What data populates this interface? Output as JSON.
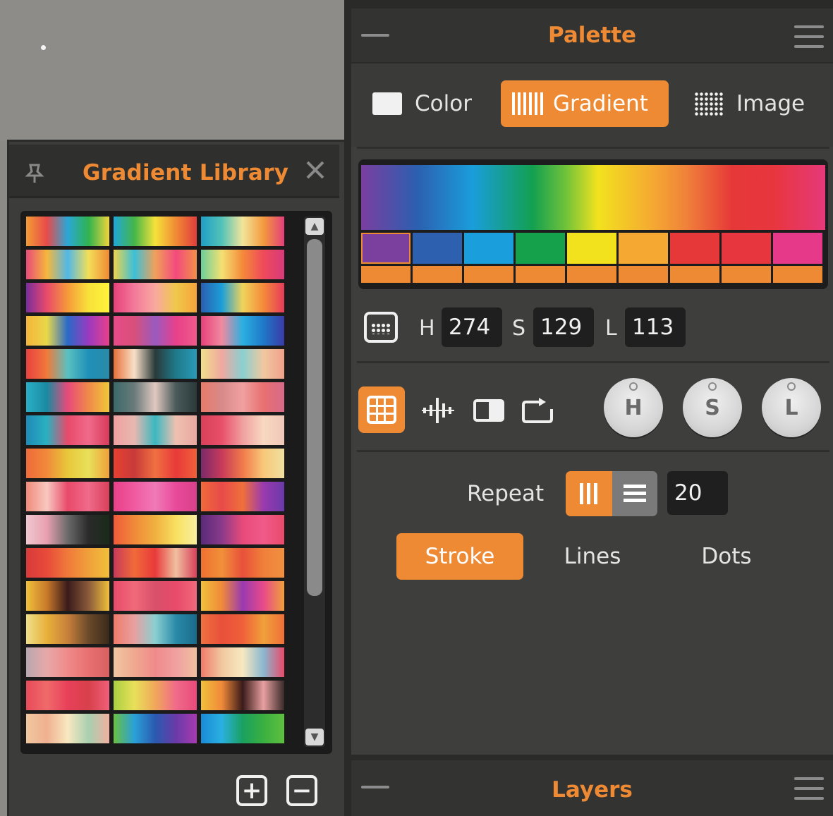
{
  "colors": {
    "accent": "#ee8a34",
    "panel": "#3e3e3d",
    "header": "#333332"
  },
  "gradient_library": {
    "title": "Gradient Library",
    "icons": {
      "pin": "pin-icon",
      "close": "close-icon",
      "add": "add-icon",
      "remove": "remove-icon"
    },
    "swatches": [
      "linear-gradient(90deg,#f39c34,#e84a4a,#2aa7d8,#2fb34f,#f0d43a)",
      "linear-gradient(90deg,#1fa7d8,#45b649,#f5e23a,#f08a34,#e23d3d)",
      "linear-gradient(90deg,#1f9ec6,#52c3b8,#f2e59a,#f39a3e,#e33f7a)",
      "linear-gradient(90deg,#e84a7a,#f6b73c,#52b8e6,#f3df58,#f08a34)",
      "linear-gradient(90deg,#f1d34a,#3bc0d8,#f0a15a,#f34a7d,#f2904a)",
      "linear-gradient(90deg,#6bcf9a,#f4e173,#f48a3a,#ef4a5a,#d83a7a)",
      "linear-gradient(90deg,#7a2c9e,#e94a6a,#f69a3a,#f7e23a,#fff23a)",
      "linear-gradient(90deg,#e8407a,#f27a9a,#f9a8a0,#f0c84a,#f6a43a)",
      "linear-gradient(90deg,#2a5fb0,#1c9ed8,#f0d45a,#f58a3a,#e63c5a)",
      "linear-gradient(90deg,#f6b43a,#e8d84a,#2a6ac8,#9a3ac0,#e8408a)",
      "linear-gradient(90deg,#e84a8a,#d8507a,#9a5ac0,#e8408a,#f05a8a)",
      "linear-gradient(90deg,#e8407a,#f08aa0,#2ab0e0,#1f78c8,#3a3aa8)",
      "linear-gradient(90deg,#e84040,#f07a3a,#5ac0c0,#1f90b8,#2a8aa8)",
      "linear-gradient(90deg,#e8703a,#f8e0c8,#2a3a3a,#1f7a8a,#2a9ab8)",
      "linear-gradient(90deg,#f0e08a,#f0a8a0,#8ad0d0,#f0c8a0,#f0a08a)",
      "linear-gradient(90deg,#2ab0c8,#1a8aa0,#e84a7a,#f08a4a,#f0c83a)",
      "linear-gradient(90deg,#3a6a6a,#6a7a7a,#e0c8c0,#4a5a5a,#2a3a3a)",
      "linear-gradient(90deg,#e87a6a,#d88a8a,#f0a0a0,#e87070,#d86a8a)",
      "linear-gradient(90deg,#1f8ab8,#2ab0c0,#e84a6a,#f06a8a,#d83a5a)",
      "linear-gradient(90deg,#f0a0a0,#e8b8b0,#3ab8c0,#f0c0b0,#e8a8a0)",
      "linear-gradient(90deg,#d8405a,#e8506a,#f0a0a0,#f8d8c0,#f0c8b8)",
      "linear-gradient(90deg,#f06a3a,#f08a3a,#e8c83a,#e8e05a,#f0a03a)",
      "linear-gradient(90deg,#e84030,#c83a3a,#f07040,#e83a3a,#f0603a)",
      "linear-gradient(90deg,#7a2a6a,#c83a5a,#f07a4a,#f8c87a,#f0e0a0)",
      "linear-gradient(90deg,#f08a7a,#f8c8c0,#e84a6a,#f06a8a,#d8405a)",
      "linear-gradient(90deg,#e8408a,#f05aa0,#f07ab8,#e84a9a,#d8408a)",
      "linear-gradient(90deg,#f06a3a,#e84a4a,#f0703a,#9a3ab0,#6a3aa8)",
      "linear-gradient(90deg,#f0c8d0,#e8a0b0,#6a6a6a,#2a2a2a,#1a2a1a)",
      "linear-gradient(90deg,#f05a3a,#f08a3a,#f0b040,#f8e060,#f8f0a0)",
      "linear-gradient(90deg,#5a2a7a,#8a3a8a,#e84a7a,#f05a8a,#e84a6a)",
      "linear-gradient(90deg,#d83a3a,#e84a3a,#f07a3a,#f0a03a,#f0c03a)",
      "linear-gradient(90deg,#c83a5a,#f06a3a,#e83a3a,#f0c0a0,#d8405a)",
      "linear-gradient(90deg,#f07030,#f0903a,#e8503a,#f0803a,#f09040)",
      "linear-gradient(90deg,#f0c03a,#c87a2a,#3a1a1a,#8a5a3a,#f0c03a)",
      "linear-gradient(90deg,#e84a6a,#f06a7a,#d8506a,#e84a6a,#f06a7a)",
      "linear-gradient(90deg,#f0c03a,#f08a3a,#9a3ab0,#e84a8a,#f0a03a)",
      "linear-gradient(90deg,#f0e08a,#e8b03a,#c8803a,#6a4a2a,#3a2a1a)",
      "linear-gradient(90deg,#f07a6a,#e8a0a0,#8ad0d0,#2a8aa8,#1a6a8a)",
      "linear-gradient(90deg,#f07040,#e8503a,#f0603a,#f0a03a,#f0703a)",
      "linear-gradient(90deg,#b8a8b0,#e8a8a8,#f08a8a,#e87070,#d86060)",
      "linear-gradient(90deg,#f0c8a0,#f0a890,#f08a8a,#f0a0a0,#f0c0a0)",
      "linear-gradient(90deg,#f07a6a,#f0c8a0,#f8e8c0,#8ab8d0,#e84a6a)",
      "linear-gradient(90deg,#e84a5a,#f06a6a,#e8405a,#d8404a,#f0607a)",
      "linear-gradient(90deg,#a8d040,#e8e05a,#f0a85a,#f06a8a,#e84a7a)",
      "linear-gradient(90deg,#f0c03a,#f08a3a,#3a1a1a,#e8a0a0,#3a2a2a)",
      "linear-gradient(90deg,#f0c8a0,#f0b090,#f8e8c0,#a8d0b0,#f0b0a0)",
      "linear-gradient(90deg,#6ac040,#2aa0d8,#2a5ab0,#6a3aa8,#a83ab0)",
      "linear-gradient(90deg,#1a8ad8,#2ab0e0,#1aa060,#3ab040,#60c040)"
    ]
  },
  "palette": {
    "title": "Palette",
    "icons": {
      "collapse": "minus-icon",
      "menu": "menu-icon"
    },
    "tabs": {
      "color": "Color",
      "gradient": "Gradient",
      "image": "Image"
    },
    "stops": [
      "#7b3f9e",
      "#2d60ae",
      "#1a9fdc",
      "#15a04c",
      "#f2e21e",
      "#f5a832",
      "#e63838",
      "#e8363f",
      "#e6398a"
    ],
    "hsl": {
      "h_label": "H",
      "h_value": "274",
      "s_label": "S",
      "s_value": "129",
      "l_label": "L",
      "l_value": "113"
    },
    "knobs": [
      "H",
      "S",
      "L"
    ],
    "repeat": {
      "label": "Repeat",
      "value": "20"
    },
    "modes": {
      "stroke": "Stroke",
      "lines": "Lines",
      "dots": "Dots"
    }
  },
  "layers": {
    "title": "Layers"
  }
}
